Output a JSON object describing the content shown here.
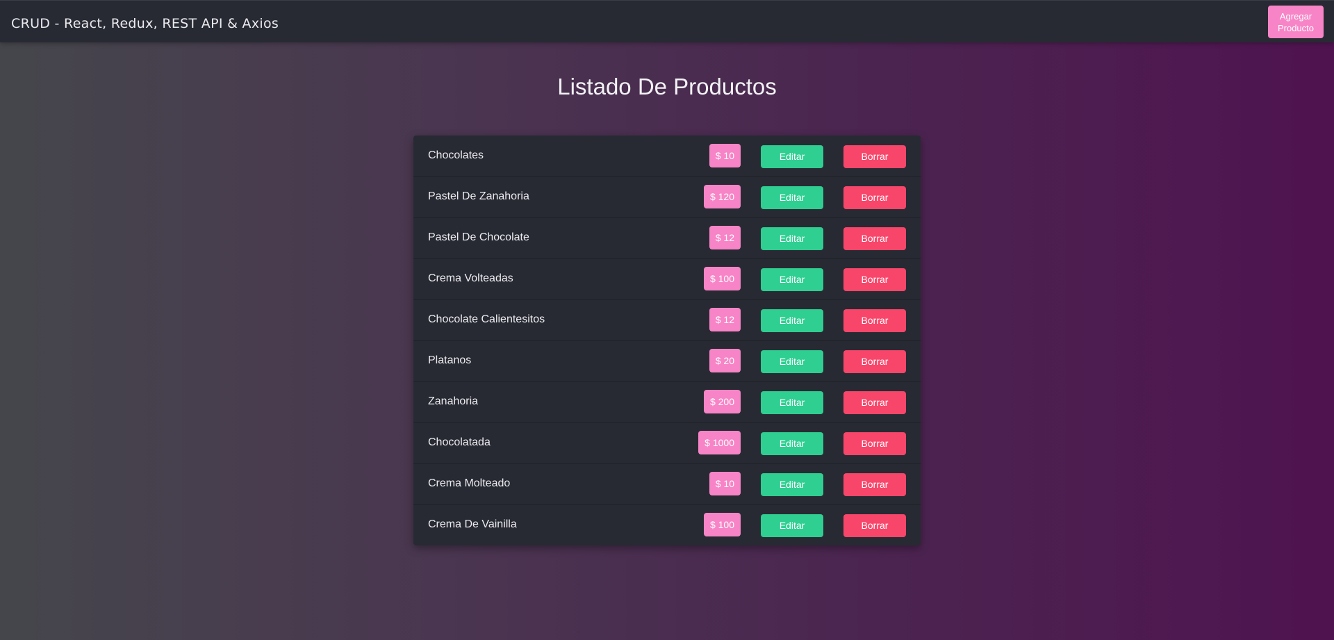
{
  "header": {
    "brand": "CRUD - React, Redux, REST API & Axios",
    "add_button_line1": "Agregar",
    "add_button_line2": "Producto"
  },
  "main": {
    "title": "Listado De Productos",
    "edit_label": "Editar",
    "delete_label": "Borrar",
    "products": [
      {
        "name": "Chocolates",
        "price": "$ 10"
      },
      {
        "name": "Pastel De Zanahoria",
        "price": "$ 120"
      },
      {
        "name": "Pastel De Chocolate",
        "price": "$ 12"
      },
      {
        "name": "Crema Volteadas",
        "price": "$ 100"
      },
      {
        "name": "Chocolate Calientesitos",
        "price": "$ 12"
      },
      {
        "name": "Platanos",
        "price": "$ 20"
      },
      {
        "name": "Zanahoria",
        "price": "$ 200"
      },
      {
        "name": "Chocolatada",
        "price": "$ 1000"
      },
      {
        "name": "Crema Molteado",
        "price": "$ 10"
      },
      {
        "name": "Crema De Vainilla",
        "price": "$ 100"
      }
    ]
  },
  "colors": {
    "navbar": "#282a33",
    "price_badge": "#f784c6",
    "edit_button": "#2fcf92",
    "delete_button": "#f8466a"
  }
}
